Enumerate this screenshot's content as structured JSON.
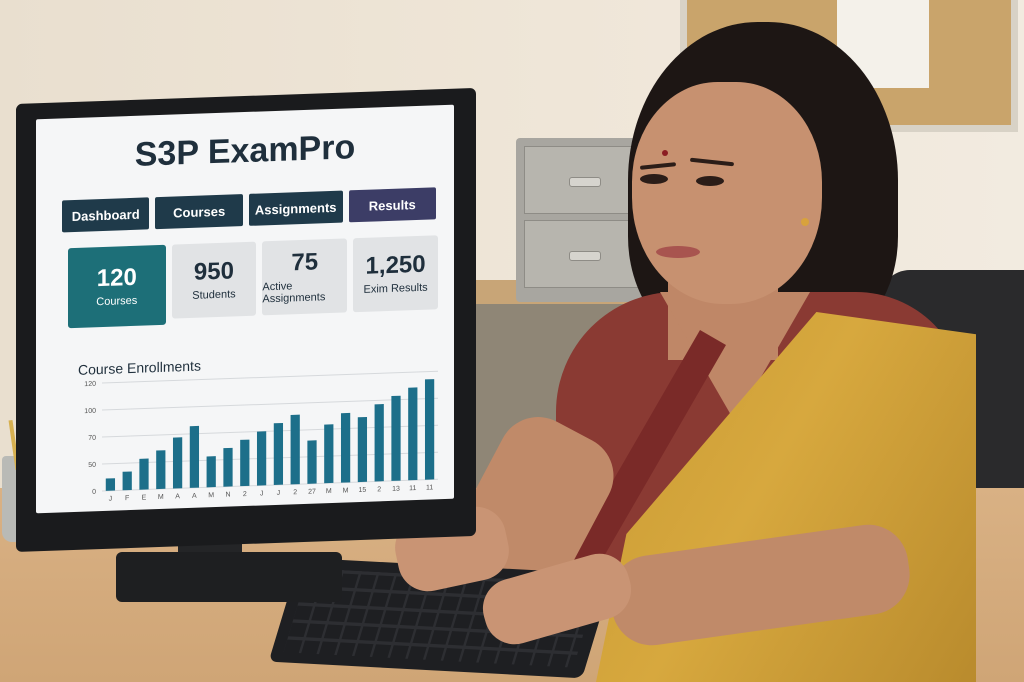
{
  "app": {
    "title": "S3P ExamPro"
  },
  "nav": [
    {
      "label": "Dashboard"
    },
    {
      "label": "Courses"
    },
    {
      "label": "Assignments"
    },
    {
      "label": "Results"
    }
  ],
  "stats": [
    {
      "value": "120",
      "label": "Courses"
    },
    {
      "value": "950",
      "label": "Students"
    },
    {
      "value": "75",
      "label": "Active Assignments"
    },
    {
      "value": "1,250",
      "label": "Exim Results"
    }
  ],
  "colors": {
    "primary": "#1d6f78",
    "nav": "#1f3a4a",
    "results": "#3c3d66",
    "bar": "#1d6f8a"
  },
  "chart_data": {
    "type": "bar",
    "title": "Course Enrollments",
    "y_ticks": [
      "0",
      "50",
      "70",
      "100",
      "120"
    ],
    "categories": [
      "J",
      "F",
      "E",
      "M",
      "A",
      "A",
      "M",
      "N",
      "2",
      "J",
      "J",
      "2",
      "27",
      "M",
      "M",
      "15",
      "2",
      "13",
      "11",
      "11"
    ],
    "values": [
      8,
      12,
      20,
      25,
      33,
      40,
      20,
      25,
      30,
      35,
      40,
      45,
      28,
      38,
      45,
      42,
      50,
      55,
      60,
      65
    ],
    "ylim": [
      0,
      70
    ],
    "grid": true
  }
}
